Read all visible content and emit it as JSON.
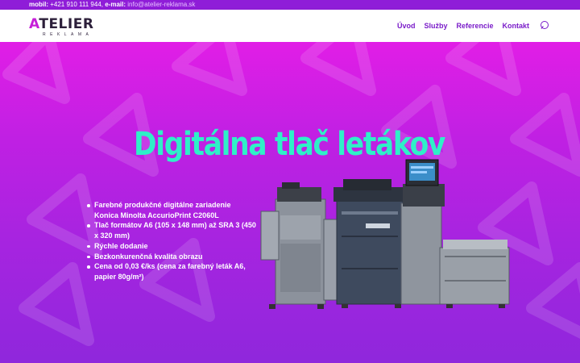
{
  "topbar": {
    "mobile_label": "mobil:",
    "mobile_value": "+421 910 111 944,",
    "email_label": "e-mail:",
    "email_value": "info@atelier-reklama.sk"
  },
  "logo": {
    "letter": "A",
    "rest": "TELIER",
    "sub": "REKLAMA"
  },
  "nav": {
    "items": [
      "Úvod",
      "Služby",
      "Referencie",
      "Kontakt"
    ]
  },
  "hero": {
    "headline": "Digitálna tlač letákov",
    "bullets": [
      "Farebné produkčné digitálne zariadenie Konica Minolta AccurioPrint C2060L",
      "Tlač formátov A6 (105 x 148 mm) až SRA 3 (450 x 320 mm)",
      "Rýchle dodanie",
      "Bezkonkurenčná kvalita obrazu",
      "Cena od 0,03 €/ks (cena za farebný leták A6, papier 80g/m²)"
    ]
  },
  "colors": {
    "accent": "#7a1cc9",
    "headline": "#2ff0c8",
    "hero_top": "#e11ee6",
    "hero_bottom": "#8f27dc"
  },
  "icons": {
    "search": "search-icon",
    "printer": "printer-image"
  }
}
